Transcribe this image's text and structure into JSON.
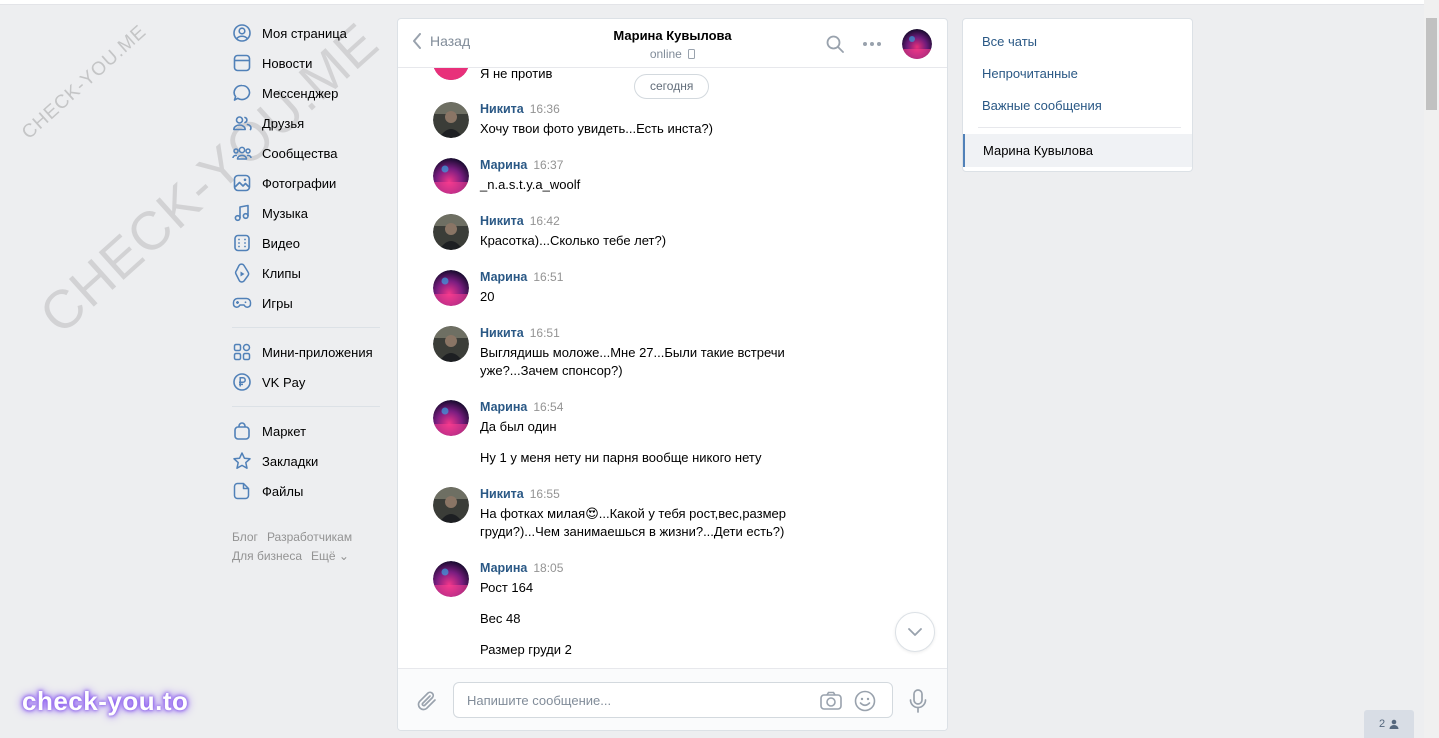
{
  "colors": {
    "link": "#2a5885",
    "background": "#edeef0",
    "accent": "#5181b8"
  },
  "watermark": {
    "small": "CHECK-YOU.ME",
    "large": "CHECK-YOU.ME",
    "brand": "check-you.to"
  },
  "nav": {
    "items": [
      {
        "label": "Моя страница",
        "icon": "user-circle-icon"
      },
      {
        "label": "Новости",
        "icon": "news-icon"
      },
      {
        "label": "Мессенджер",
        "icon": "message-bubble-icon"
      },
      {
        "label": "Друзья",
        "icon": "friends-icon"
      },
      {
        "label": "Сообщества",
        "icon": "communities-icon"
      },
      {
        "label": "Фотографии",
        "icon": "photo-icon"
      },
      {
        "label": "Музыка",
        "icon": "music-note-icon"
      },
      {
        "label": "Видео",
        "icon": "video-icon"
      },
      {
        "label": "Клипы",
        "icon": "clips-icon"
      },
      {
        "label": "Игры",
        "icon": "gamepad-icon"
      }
    ],
    "items2": [
      {
        "label": "Мини-приложения",
        "icon": "apps-grid-icon"
      },
      {
        "label": "VK Pay",
        "icon": "ruble-icon"
      }
    ],
    "items3": [
      {
        "label": "Маркет",
        "icon": "shopping-bag-icon"
      },
      {
        "label": "Закладки",
        "icon": "star-icon"
      },
      {
        "label": "Файлы",
        "icon": "file-icon"
      }
    ],
    "footer": {
      "blog": "Блог",
      "devs": "Разработчикам",
      "business": "Для бизнеса",
      "more": "Ещё ⌄"
    }
  },
  "chat": {
    "back_label": "Назад",
    "title": "Марина Кувылова",
    "status": "online",
    "date_divider": "сегодня",
    "top_fragment": "Я не против",
    "messages": [
      {
        "author": "Никита",
        "time": "16:36",
        "lines": [
          "Хочу твои фото увидеть...Есть инста?)"
        ]
      },
      {
        "author": "Марина",
        "time": "16:37",
        "lines": [
          "_n.a.s.t.y.a_woolf"
        ]
      },
      {
        "author": "Никита",
        "time": "16:42",
        "lines": [
          "Красотка)...Сколько тебе лет?)"
        ]
      },
      {
        "author": "Марина",
        "time": "16:51",
        "lines": [
          "20"
        ]
      },
      {
        "author": "Никита",
        "time": "16:51",
        "lines": [
          "Выглядишь моложе...Мне 27...Были такие встречи",
          "уже?...Зачем спонсор?)"
        ]
      },
      {
        "author": "Марина",
        "time": "16:54",
        "lines": [
          "Да был один",
          "Ну 1 у меня нету ни парня вообще никого нету"
        ]
      },
      {
        "author": "Никита",
        "time": "16:55",
        "lines": [
          "На фотках милая😍...Какой у тебя рост,вес,размер",
          "груди?)...Чем занимаешься в жизни?...Дети есть?)"
        ]
      },
      {
        "author": "Марина",
        "time": "18:05",
        "lines": [
          "Рост 164",
          "Вес 48",
          "Размер груди 2"
        ]
      }
    ],
    "composer": {
      "placeholder": "Напишите сообщение..."
    }
  },
  "right_panel": {
    "all_chats": "Все чаты",
    "unread": "Непрочитанные",
    "important": "Важные сообщения",
    "selected": "Марина Кувылова"
  },
  "online_badge": "2"
}
